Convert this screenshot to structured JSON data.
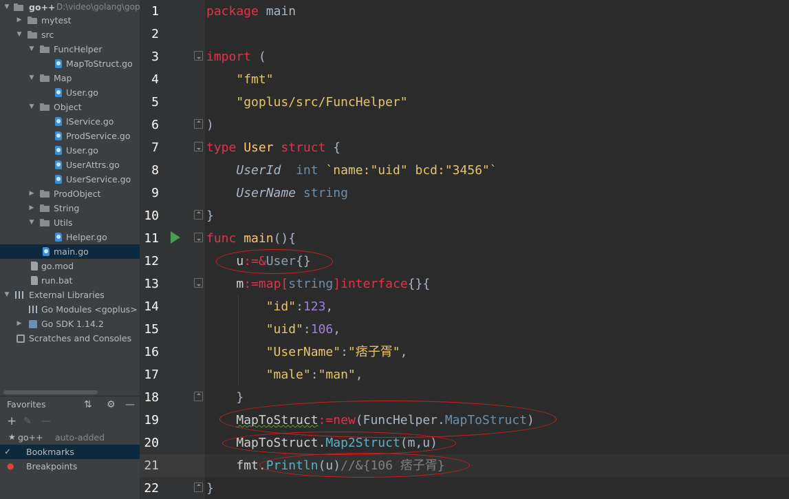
{
  "project_tree": {
    "root": {
      "name": "go++",
      "path": "D:\\video\\golang\\gop"
    },
    "items": [
      {
        "label": "mytest"
      },
      {
        "label": "src"
      },
      {
        "label": "FuncHelper"
      },
      {
        "label": "MapToStruct.go"
      },
      {
        "label": "Map"
      },
      {
        "label": "User.go"
      },
      {
        "label": "Object"
      },
      {
        "label": "IService.go"
      },
      {
        "label": "ProdService.go"
      },
      {
        "label": "User.go"
      },
      {
        "label": "UserAttrs.go"
      },
      {
        "label": "UserService.go"
      },
      {
        "label": "ProdObject"
      },
      {
        "label": "String"
      },
      {
        "label": "Utils"
      },
      {
        "label": "Helper.go"
      },
      {
        "label": "main.go"
      },
      {
        "label": "go.mod"
      },
      {
        "label": "run.bat"
      },
      {
        "label": "External Libraries"
      },
      {
        "label": "Go Modules <goplus>"
      },
      {
        "label": "Go SDK 1.14.2"
      },
      {
        "label": "Scratches and Consoles"
      }
    ]
  },
  "favorites": {
    "title": "Favorites",
    "items": [
      {
        "label": "go++",
        "suffix": "auto-added"
      },
      {
        "label": "Bookmarks"
      },
      {
        "label": "Breakpoints"
      }
    ]
  },
  "editor": {
    "line_numbers": [
      "1",
      "2",
      "3",
      "4",
      "5",
      "6",
      "7",
      "8",
      "9",
      "10",
      "11",
      "12",
      "13",
      "14",
      "15",
      "16",
      "17",
      "18",
      "19",
      "20",
      "21",
      "22"
    ],
    "tokens": {
      "l1_kw": "package",
      "l1_name": "main",
      "l3_kw": "import",
      "l3_paren": "(",
      "l4_str": "\"fmt\"",
      "l5_str": "\"goplus/src/FuncHelper\"",
      "l6_paren": ")",
      "l7_kw": "type",
      "l7_name": "User",
      "l7_kw2": "struct",
      "l7_brace": "{",
      "l8_field": "UserId",
      "l8_type": "int",
      "l8_tag_a": "`name:",
      "l8_tag_b": "\"uid\"",
      "l8_tag_c": " bcd:",
      "l8_tag_d": "\"3456\"",
      "l8_tag_e": "`",
      "l9_field": "UserName",
      "l9_type": "string",
      "l10_brace": "}",
      "l11_kw": "func",
      "l11_fn": "main",
      "l11_rest": "(){",
      "l12_var": "u",
      "l12_op": ":=&",
      "l12_type": "User",
      "l12_rest": "{}",
      "l13_var": "m",
      "l13_op": ":=",
      "l13_map": "map",
      "l13_b1": "[",
      "l13_string": "string",
      "l13_b2": "]",
      "l13_iface": "interface",
      "l13_rest": "{}{",
      "l14_key": "\"id\"",
      "l14_colon": ":",
      "l14_val": "123",
      "l14_comma": ",",
      "l15_key": "\"uid\"",
      "l15_colon": ":",
      "l15_val": "106",
      "l15_comma": ",",
      "l16_key": "\"UserName\"",
      "l16_colon": ":",
      "l16_val": "\"痞子胥\"",
      "l16_comma": ",",
      "l17_key": "\"male\"",
      "l17_colon": ":",
      "l17_val": "\"man\"",
      "l17_comma": ",",
      "l18_brace": "}",
      "l19_var": "MapToStruct",
      "l19_op": ":=",
      "l19_new": "new",
      "l19_p1": "(FuncHelper.",
      "l19_type": "MapToStruct",
      "l19_p2": ")",
      "l20_var": "MapToStruct.",
      "l20_fn": "Map2Struct",
      "l20_args": "(m,u)",
      "l21_pkg": "fmt.",
      "l21_fn": "Println",
      "l21_args": "(u)",
      "l21_comment": "//&{106 痞子胥}",
      "l22_brace": "}"
    }
  },
  "colors": {
    "keyword": "#e0344e",
    "string": "#e6c668",
    "number": "#9f7fd9",
    "function": "#ffc66d",
    "annotation_circle": "#d21f1f",
    "run_gutter_icon": "#499c54"
  }
}
